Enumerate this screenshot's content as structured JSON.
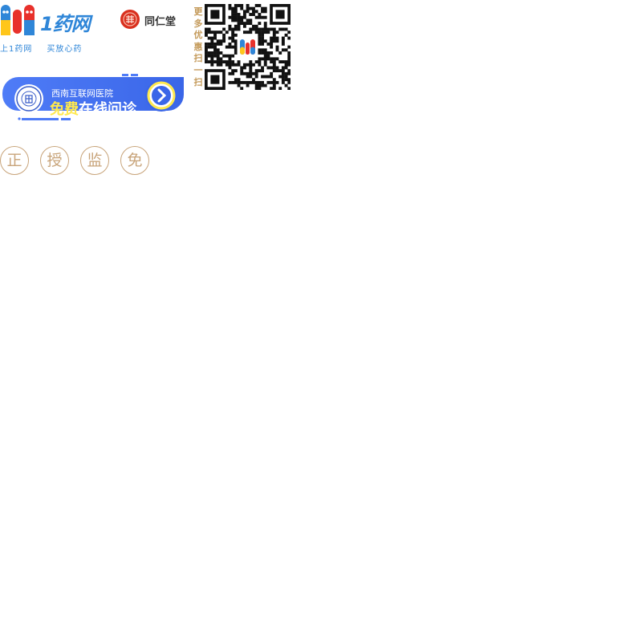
{
  "logo": {
    "brand": "1药网",
    "slogan": [
      "上1药网",
      "买放心药"
    ],
    "colors": {
      "blue": "#2f86d8",
      "red": "#e8312b",
      "yellow": "#ffc61a"
    }
  },
  "partner": {
    "name": "同仁堂",
    "icon": "tongrentang-seal-icon"
  },
  "qr": {
    "caption": [
      "更",
      "多",
      "优",
      "惠",
      "扫",
      "一",
      "扫"
    ],
    "icon": "qr-code-icon"
  },
  "banner": {
    "org": "西南互联网医院",
    "title_highlight": "免费",
    "title_rest": "在线问诊",
    "go_icon": "chevron-right-icon",
    "colors": {
      "bg": "#4f7cf7",
      "highlight": "#ffe94d"
    }
  },
  "promises": [
    "正",
    "授",
    "监",
    "免"
  ]
}
